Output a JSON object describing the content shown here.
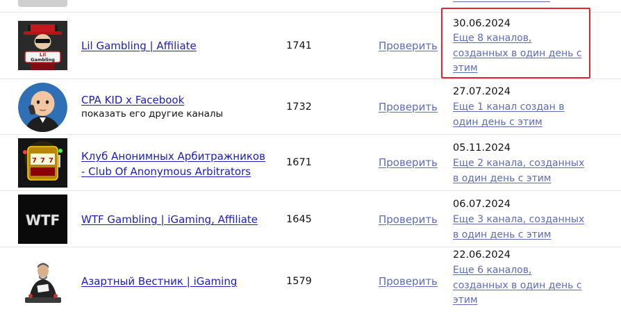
{
  "rows": [
    {
      "name": "Lil Gambling | Affiliate",
      "subtext": "",
      "count": "1741",
      "check_label": "Проверить",
      "date": "30.06.2024",
      "more": "Еще 8 каналов, созданных в один день с этим",
      "highlighted": true
    },
    {
      "name": "CPA KID x Facebook",
      "subtext": "показать его другие каналы",
      "count": "1732",
      "check_label": "Проверить",
      "date": "27.07.2024",
      "more": "Еще 1 канал создан в один день с этим"
    },
    {
      "name": "Клуб Анонимных Арбитражников - Club Of Anonymous Arbitrators",
      "subtext": "",
      "count": "1671",
      "check_label": "Проверить",
      "date": "05.11.2024",
      "more": "Еще 2 канала, созданных в один день с этим"
    },
    {
      "name": "WTF Gambling | iGaming, Affiliate",
      "subtext": "",
      "count": "1645",
      "check_label": "Проверить",
      "date": "06.07.2024",
      "more": "Еще 3 канала, созданных в один день с этим"
    },
    {
      "name": "Азартный Вестник | iGaming",
      "subtext": "",
      "count": "1579",
      "check_label": "Проверить",
      "date": "22.06.2024",
      "more": "Еще 6 каналов, созданных в один день с этим"
    }
  ],
  "avatars": {
    "row1": {
      "logo_text": "Lil Gambling"
    },
    "row4": {
      "logo_text": "WTF"
    }
  },
  "colors": {
    "link": "#1a1acc",
    "secondary_link": "#5a6bbf",
    "highlight": "#e0242d"
  }
}
